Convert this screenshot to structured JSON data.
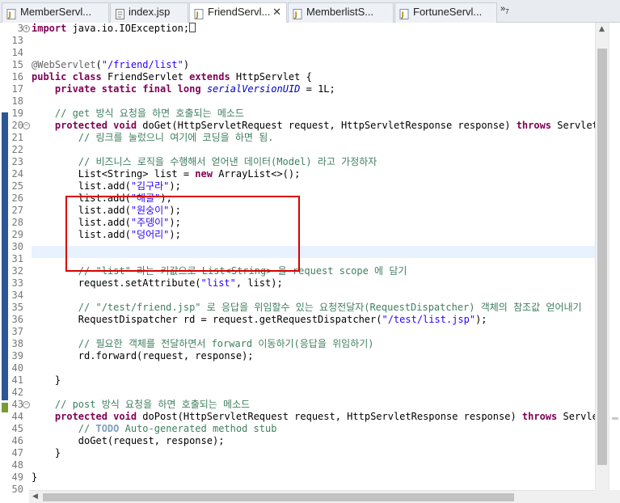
{
  "tabs": [
    {
      "label": "MemberServl...",
      "active": false,
      "close": ""
    },
    {
      "label": "index.jsp",
      "active": false,
      "close": ""
    },
    {
      "label": "FriendServl...",
      "active": true,
      "close": "✕"
    },
    {
      "label": "MemberlistS...",
      "active": false,
      "close": ""
    },
    {
      "label": "FortuneServl...",
      "active": false,
      "close": ""
    }
  ],
  "overflow": {
    "symbol": "»",
    "count": "7"
  },
  "colors": {
    "keyword": "#7f0055",
    "string": "#2a00ff",
    "comment": "#3f7f5f",
    "highlight_box": "#d90000",
    "current_line": "#e8f2fe"
  },
  "editor": {
    "lines": [
      {
        "no": "3",
        "fold": "+",
        "text": "import java.io.IOException;"
      },
      {
        "no": "13",
        "text": ""
      },
      {
        "no": "14",
        "text": ""
      },
      {
        "no": "15",
        "text": "@WebServlet(\"/friend/list\")"
      },
      {
        "no": "16",
        "text": "public class FriendServlet extends HttpServlet {"
      },
      {
        "no": "17",
        "text": "    private static final long serialVersionUID = 1L;"
      },
      {
        "no": "18",
        "text": ""
      },
      {
        "no": "19",
        "text": "    // get 방식 요청을 하면 호출되는 메소드"
      },
      {
        "no": "20",
        "fold": "−",
        "text": "    protected void doGet(HttpServletRequest request, HttpServletResponse response) throws ServletExc"
      },
      {
        "no": "21",
        "text": "        // 링크를 눌렀으니 여기에 코딩을 하면 됨."
      },
      {
        "no": "22",
        "text": ""
      },
      {
        "no": "23",
        "text": "        // 비즈니스 로직을 수행해서 얻어낸 데이터(Model) 라고 가정하자"
      },
      {
        "no": "24",
        "text": "        List<String> list = new ArrayList<>();"
      },
      {
        "no": "25",
        "text": "        list.add(\"김구라\");"
      },
      {
        "no": "26",
        "text": "        list.add(\"해골\");"
      },
      {
        "no": "27",
        "text": "        list.add(\"원숭이\");"
      },
      {
        "no": "28",
        "text": "        list.add(\"주뎅이\");"
      },
      {
        "no": "29",
        "text": "        list.add(\"덩어리\");"
      },
      {
        "no": "30",
        "text": ""
      },
      {
        "no": "31",
        "text": ""
      },
      {
        "no": "32",
        "text": "        // \"list\" 라는 키값으로 List<String> 을 request scope 에 담기"
      },
      {
        "no": "33",
        "text": "        request.setAttribute(\"list\", list);"
      },
      {
        "no": "34",
        "text": ""
      },
      {
        "no": "35",
        "text": "        // \"/test/friend.jsp\" 로 응답을 위임할수 있는 요청전달자(RequestDispatcher) 객체의 참조값 얻어내기"
      },
      {
        "no": "36",
        "text": "        RequestDispatcher rd = request.getRequestDispatcher(\"/test/list.jsp\");"
      },
      {
        "no": "37",
        "text": ""
      },
      {
        "no": "38",
        "text": "        // 필요한 객체를 전달하면서 forward 이동하기(응답을 위임하기)"
      },
      {
        "no": "39",
        "text": "        rd.forward(request, response);"
      },
      {
        "no": "40",
        "text": ""
      },
      {
        "no": "41",
        "text": "    }"
      },
      {
        "no": "42",
        "text": ""
      },
      {
        "no": "43",
        "fold": "−",
        "text": "    // post 방식 요청을 하면 호출되는 메소드"
      },
      {
        "no": "44",
        "text": "    protected void doPost(HttpServletRequest request, HttpServletResponse response) throws ServletEx"
      },
      {
        "no": "45",
        "text": "        // TODO Auto-generated method stub"
      },
      {
        "no": "46",
        "text": "        doGet(request, response);"
      },
      {
        "no": "47",
        "text": "    }"
      },
      {
        "no": "48",
        "text": ""
      },
      {
        "no": "49",
        "text": "}"
      },
      {
        "no": "50",
        "text": ""
      }
    ]
  }
}
